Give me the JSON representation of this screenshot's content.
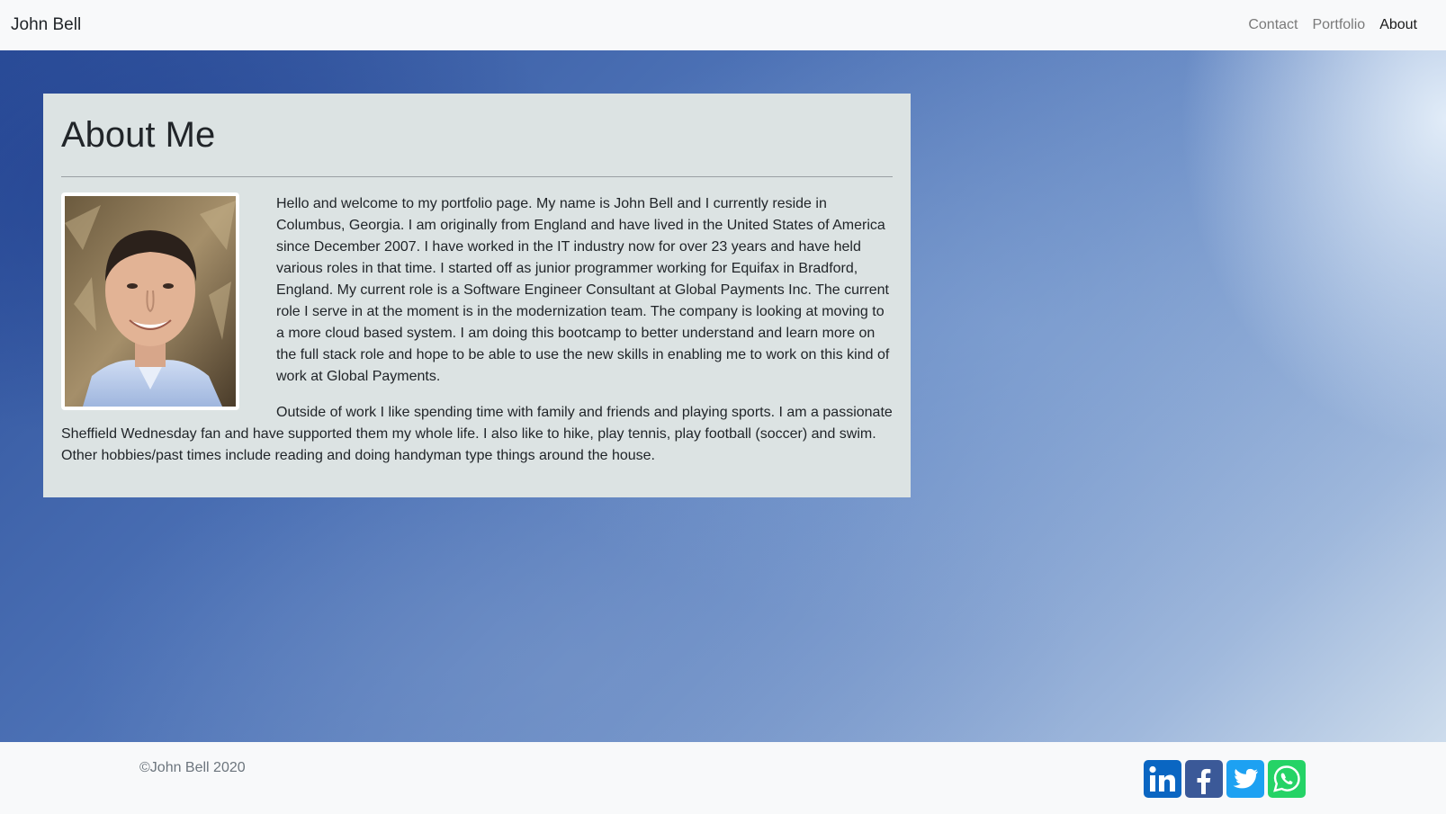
{
  "navbar": {
    "brand": "John Bell",
    "links": [
      {
        "label": "Contact",
        "active": false
      },
      {
        "label": "Portfolio",
        "active": false
      },
      {
        "label": "About",
        "active": true
      }
    ]
  },
  "about": {
    "title": "About Me",
    "photo_alt": "portrait-photo",
    "paragraphs": [
      "Hello and welcome to my portfolio page. My name is John Bell and I currently reside in Columbus, Georgia. I am originally from England and have lived in the United States of America since December 2007. I have worked in the IT industry now for over 23 years and have held various roles in that time. I started off as junior programmer working for Equifax in Bradford, England. My current role is a Software Engineer Consultant at Global Payments Inc. The current role I serve in at the moment is in the modernization team. The company is looking at moving to a more cloud based system. I am doing this bootcamp to better understand and learn more on the full stack role and hope to be able to use the new skills in enabling me to work on this kind of work at Global Payments.",
      "Outside of work I like spending time with family and friends and playing sports. I am a passionate Sheffield Wednesday fan and have supported them my whole life. I also like to hike, play tennis, play football (soccer) and swim. Other hobbies/past times include reading and doing handyman type things around the house."
    ]
  },
  "footer": {
    "copyright": "©John Bell 2020",
    "socials": [
      {
        "name": "linkedin-icon",
        "color": "#0a66c2"
      },
      {
        "name": "facebook-icon",
        "color": "#3b5998"
      },
      {
        "name": "twitter-icon",
        "color": "#1da1f2"
      },
      {
        "name": "whatsapp-icon",
        "color": "#25d366"
      }
    ]
  },
  "colors": {
    "card_bg": "#dce3e3",
    "nav_bg": "#f8f9fa",
    "hero_blue": "#4c71b5"
  }
}
